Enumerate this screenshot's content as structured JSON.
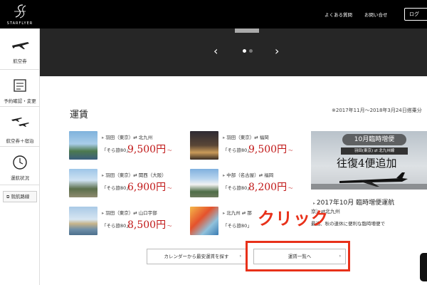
{
  "header": {
    "logo_text": "STARFLYER",
    "faq": "よくある質問",
    "contact": "お問い合せ",
    "login": "ログ"
  },
  "sidebar": {
    "items": [
      {
        "label": "航空券",
        "icon": "airplane-icon"
      },
      {
        "label": "予約確認・変更",
        "icon": "ticket-icon"
      },
      {
        "label": "航空券＋宿泊",
        "icon": "plane-hotel-icon"
      },
      {
        "label": "運航状況",
        "icon": "clock-icon"
      }
    ],
    "route_map": "就航路線"
  },
  "hero": {
    "prev": "‹",
    "next": "›"
  },
  "fares": {
    "title": "運賃",
    "period": "※2017年11月〜2018年3月24日搭乗分",
    "items": [
      {
        "route": "羽田（東京）⇄ 北九州",
        "plan": "「そら旅80」",
        "price": "9,500円",
        "suffix": "〜"
      },
      {
        "route": "羽田（東京）⇄ 福岡",
        "plan": "「そら旅80」",
        "price": "9,500円",
        "suffix": "〜"
      },
      {
        "route": "羽田（東京）⇄ 関西（大阪）",
        "plan": "「そら旅80」",
        "price": "6,900円",
        "suffix": "〜"
      },
      {
        "route": "中部（名古屋）⇄ 福岡",
        "plan": "「そら旅80」",
        "price": "8,200円",
        "suffix": "〜"
      },
      {
        "route": "羽田（東京）⇄ 山口宇部",
        "plan": "「そら旅80」",
        "price": "8,500円",
        "suffix": "〜"
      },
      {
        "route": "北九州 ⇄ 那",
        "plan": "「そら旅80」",
        "price": "",
        "suffix": ""
      }
    ]
  },
  "promo": {
    "banner_top": "10月臨時増便",
    "banner_route": "羽田(東京) ⇄ 北九州線",
    "banner_big": "往復4便追加",
    "title": "2017年10月 臨時増便運航",
    "route": "京）⇄北九州",
    "desc": "最適、秋の連休に便利な臨時増便で"
  },
  "annotation": {
    "click": "クリック"
  },
  "buttons": {
    "calendar": "カレンダーから最安運賃を探す",
    "fare_list": "運賃一覧へ",
    "caret": "›"
  },
  "colors": {
    "price_red": "#c01616",
    "annotation_red": "#e8311a",
    "topbar": "#000000",
    "hero": "#262626"
  }
}
